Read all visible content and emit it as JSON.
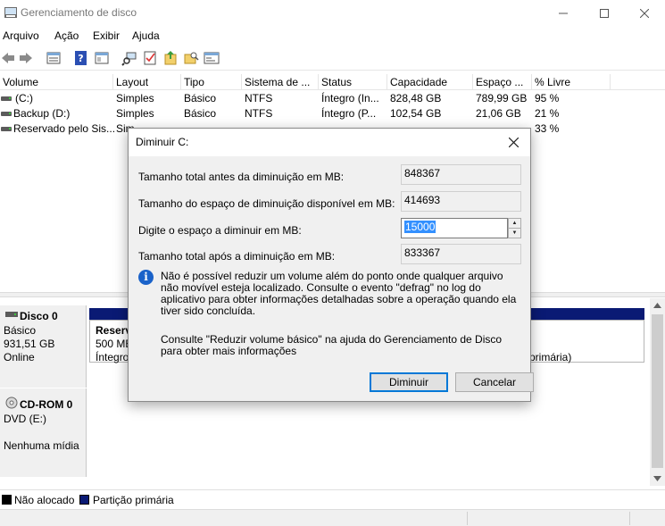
{
  "window": {
    "title": "Gerenciamento de disco"
  },
  "menu": [
    "Arquivo",
    "Ação",
    "Exibir",
    "Ajuda"
  ],
  "toolbar_icons": [
    "back-icon",
    "forward-icon",
    "volume-list-icon",
    "help-icon",
    "properties-icon",
    "rescan-icon",
    "checklist-icon",
    "export-icon",
    "search-folder-icon",
    "console-icon"
  ],
  "columns": [
    "Volume",
    "Layout",
    "Tipo",
    "Sistema de ...",
    "Status",
    "Capacidade",
    "Espaço ...",
    "% Livre"
  ],
  "volumes": [
    [
      "(C:)",
      "Simples",
      "Básico",
      "NTFS",
      "Íntegro (In...",
      "828,48 GB",
      "789,99 GB",
      "95 %"
    ],
    [
      "Backup (D:)",
      "Simples",
      "Básico",
      "NTFS",
      "Íntegro (P...",
      "102,54 GB",
      "21,06 GB",
      "21 %"
    ],
    [
      "Reservado pelo Sis...",
      "Sim",
      "",
      "",
      "",
      "",
      "",
      "33 %"
    ]
  ],
  "disks": {
    "disk0": {
      "name": "Disco 0",
      "type": "Básico",
      "size": "931,51 GB",
      "status": "Online",
      "partition": {
        "name": "Reserv",
        "size": "500 MB",
        "status": "Íntegro",
        "status_right": "primária)"
      }
    },
    "cdrom": {
      "name": "CD-ROM 0",
      "drive": "DVD (E:)",
      "media": "Nenhuma mídia"
    }
  },
  "legend": [
    {
      "label": "Não alocado",
      "color": "#000000"
    },
    {
      "label": "Partição primária",
      "color": "#0a1a74"
    }
  ],
  "dialog": {
    "title": "Diminuir C:",
    "total_before_label": "Tamanho total antes da diminuição em MB:",
    "total_before_value": "848367",
    "available_label": "Tamanho do espaço de diminuição disponível em MB:",
    "available_value": "414693",
    "amount_label": "Digite o espaço a diminuir em MB:",
    "amount_value": "15000",
    "total_after_label": "Tamanho total após a diminuição em MB:",
    "total_after_value": "833367",
    "info_text": "Não é possível reduzir um volume além do ponto onde qualquer arquivo não movível esteja localizado. Consulte o evento \"defrag\" no log do aplicativo para obter informações detalhadas sobre a operação quando ela tiver sido concluída.",
    "help_text": "Consulte \"Reduzir volume básico\" na ajuda do Gerenciamento de Disco para obter mais informações",
    "ok_label": "Diminuir",
    "cancel_label": "Cancelar"
  },
  "colors": {
    "accent": "#0078d7",
    "partition": "#0a1a74",
    "selection": "#3390ff"
  }
}
